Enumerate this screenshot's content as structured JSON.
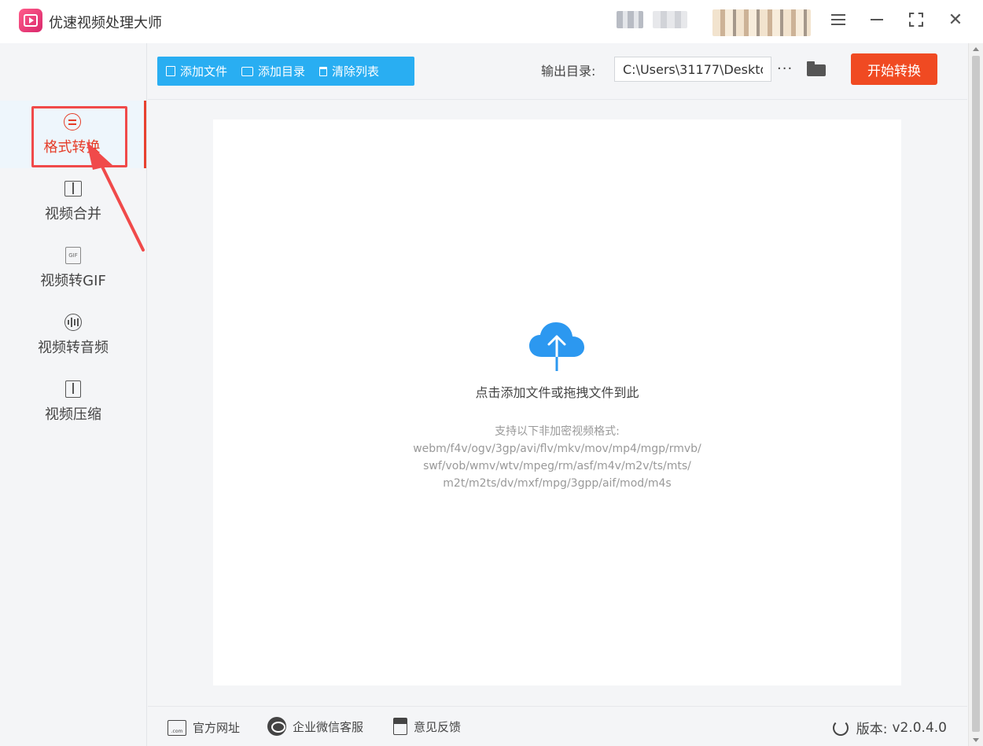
{
  "app": {
    "title": "优速视频处理大师"
  },
  "sidebar": {
    "items": [
      {
        "label": "格式转换",
        "icon": "convert-icon",
        "active": true
      },
      {
        "label": "视频合并",
        "icon": "merge-icon"
      },
      {
        "label": "视频转GIF",
        "icon": "gif-icon",
        "icon_text": "GIF"
      },
      {
        "label": "视频转音频",
        "icon": "audio-icon"
      },
      {
        "label": "视频压缩",
        "icon": "compress-icon"
      }
    ]
  },
  "toolbar": {
    "add_file": "添加文件",
    "add_folder": "添加目录",
    "clear_list": "清除列表",
    "output_label": "输出目录:",
    "output_path": "C:\\Users\\31177\\Deskto",
    "more": "···",
    "start": "开始转换"
  },
  "dropzone": {
    "title": "点击添加文件或拖拽文件到此",
    "support_title": "支持以下非加密视频格式:",
    "formats_lines": [
      "webm/f4v/ogv/3gp/avi/flv/mkv/mov/mp4/mgp/rmvb/",
      "swf/vob/wmv/wtv/mpeg/rm/asf/m4v/m2v/ts/mts/",
      "m2t/m2ts/dv/mxf/mpg/3gpp/aif/mod/m4s"
    ]
  },
  "footer": {
    "website": "官方网址",
    "website_icon_text": ".com",
    "wechat": "企业微信客服",
    "feedback": "意见反馈",
    "version_label": "版本:",
    "version": "v2.0.4.0"
  },
  "colors": {
    "accent_blue": "#29aef2",
    "start_red": "#f04a22",
    "active_red": "#e53c27",
    "annotation_red": "#f04a4a",
    "cloud_blue": "#2c98f0"
  }
}
